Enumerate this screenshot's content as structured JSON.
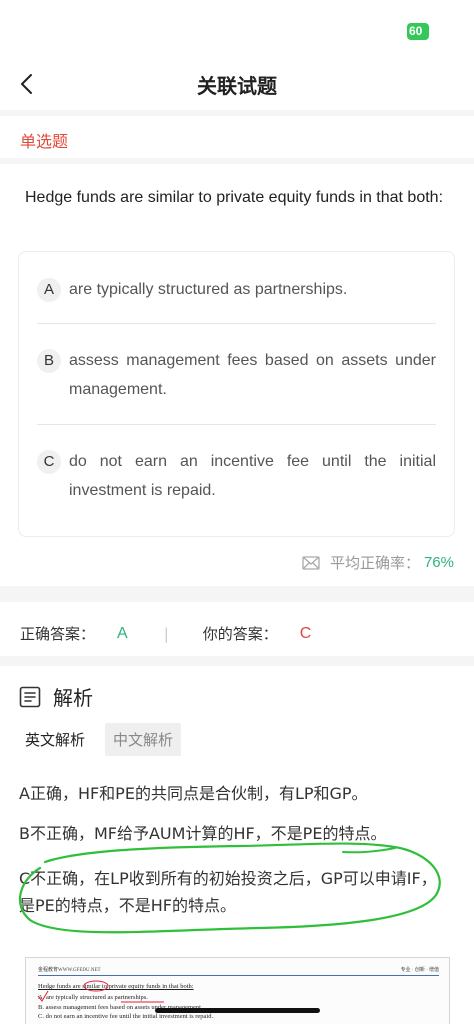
{
  "status": {
    "battery": "60"
  },
  "nav": {
    "title": "关联试题"
  },
  "question": {
    "type": "单选题",
    "stem": "Hedge funds are similar to private equity funds in that both:",
    "options": [
      {
        "letter": "A",
        "text": "are typically structured as partnerships."
      },
      {
        "letter": "B",
        "text": "assess management fees based on assets under management."
      },
      {
        "letter": "C",
        "text": "do not earn an incentive fee until the initial investment is repaid."
      }
    ]
  },
  "stats": {
    "accuracy_label": "平均正确率：",
    "accuracy_value": "76%"
  },
  "answers": {
    "correct_label": "正确答案：",
    "correct_value": "A",
    "separator": "|",
    "yours_label": "你的答案：",
    "yours_value": "C"
  },
  "analysis": {
    "title": "解析",
    "tabs": [
      "英文解析",
      "中文解析"
    ],
    "active_tab": "中文解析",
    "lines": [
      "A正确，HF和PE的共同点是合伙制，有LP和GP。",
      "B不正确，MF给予AUM计算的HF，不是PE的特点。",
      "C不正确，在LP收到所有的初始投资之后，GP可以申请IF，是PE的特点，不是HF的特点。"
    ]
  },
  "scan": {
    "header_left": "金程教育WWW.GFEDU.NET",
    "header_right": "专业 · 创新 · 增值",
    "lines": [
      "Hedge funds are similar to private equity funds in that both:",
      "A.  are typically structured as partnerships.",
      "B.  assess management fees based on assets under management.",
      "C.  do not earn an incentive fee until the initial investment is repaid."
    ]
  },
  "colors": {
    "red": "#e04a3b",
    "green": "#2db37d",
    "annotation_green": "#2fbf3a"
  }
}
